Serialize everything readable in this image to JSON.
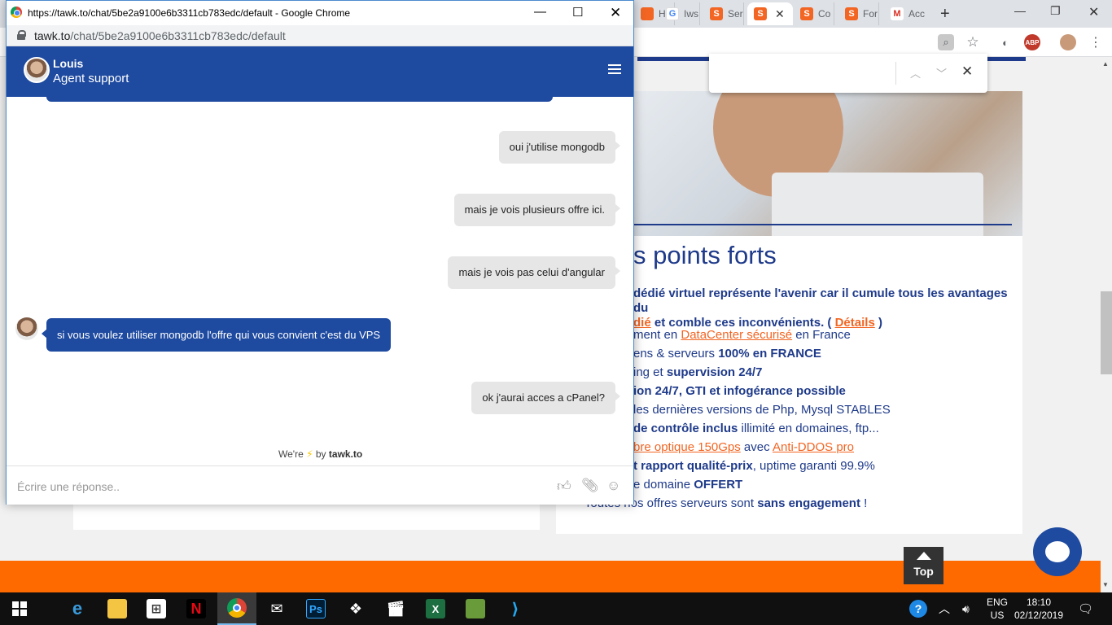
{
  "popup": {
    "title": "https://tawk.to/chat/5be2a9100e6b3311cb783edc/default - Google Chrome",
    "url_host": "tawk.to",
    "url_path": "/chat/5be2a9100e6b3311cb783edc/default"
  },
  "chat": {
    "agent_name": "Louis",
    "agent_role": "Agent support",
    "messages": [
      {
        "from": "visitor",
        "text": "oui j'utilise mongodb"
      },
      {
        "from": "visitor",
        "text": "mais je vois plusieurs offre ici."
      },
      {
        "from": "visitor",
        "text": "mais je vois pas celui d'angular"
      },
      {
        "from": "agent",
        "text": "si vous voulez utiliser mongodb l'offre qui vous convient c'est du VPS"
      },
      {
        "from": "visitor",
        "text": "ok j'aurai acces a cPanel?"
      }
    ],
    "powered_prefix": "We're",
    "powered_by": "by",
    "powered_brand": "tawk.to",
    "composer_placeholder": "Écrire une réponse.."
  },
  "browser_tabs": [
    {
      "label": "Ho",
      "icon": "orange-page-icon"
    },
    {
      "label": "Iws",
      "icon": "google-icon"
    },
    {
      "label": "Ser",
      "icon": "orange-s-icon"
    },
    {
      "label": "",
      "icon": "orange-s-icon",
      "active": true
    },
    {
      "label": "Co",
      "icon": "orange-s-icon"
    },
    {
      "label": "For",
      "icon": "orange-s-icon"
    },
    {
      "label": "Acc",
      "icon": "gmail-icon"
    }
  ],
  "page": {
    "heading": "s points forts",
    "intro_bold_1": "dédié virtuel représente l'avenir car il cumule tous les avantages du",
    "intro_link_1": "dié",
    "intro_bold_2": " et comble ces inconvénients. ( ",
    "intro_link_2": "Détails",
    "intro_end": " )",
    "features": [
      {
        "pre": "ment en ",
        "link": "DataCenter sécurisé",
        "post": " en France"
      },
      {
        "pre": "ens & serveurs ",
        "bold": "100% en FRANCE"
      },
      {
        "pre": "ing et ",
        "bold": "supervision 24/7"
      },
      {
        "bold": "ion 24/7, GTI et infogérance possible"
      },
      {
        "pre": " les dernières versions de Php, Mysql STABLES"
      },
      {
        "bold": " de contrôle inclus",
        "post": " illimité en domaines, ftp..."
      },
      {
        "link": "bre optique 150Gps",
        "post": " avec ",
        "link2": "Anti-DDOS pro"
      },
      {
        "bold": "t rapport qualité-prix",
        "post": ", uptime garanti 99.9%"
      },
      {
        "pre": "e domaine ",
        "bold": "OFFERT"
      },
      {
        "pre": "- Toutes nos offres serveurs sont ",
        "bold": "sans engagement",
        "post": " !"
      }
    ],
    "top_button": "Top"
  },
  "taskbar": {
    "lang_top": "ENG",
    "lang_bottom": "US",
    "time": "18:10",
    "date": "02/12/2019"
  },
  "colors": {
    "tawk_blue": "#1e4aa0",
    "brand_orange": "#ff6a00",
    "page_blue": "#1e3a8a"
  }
}
